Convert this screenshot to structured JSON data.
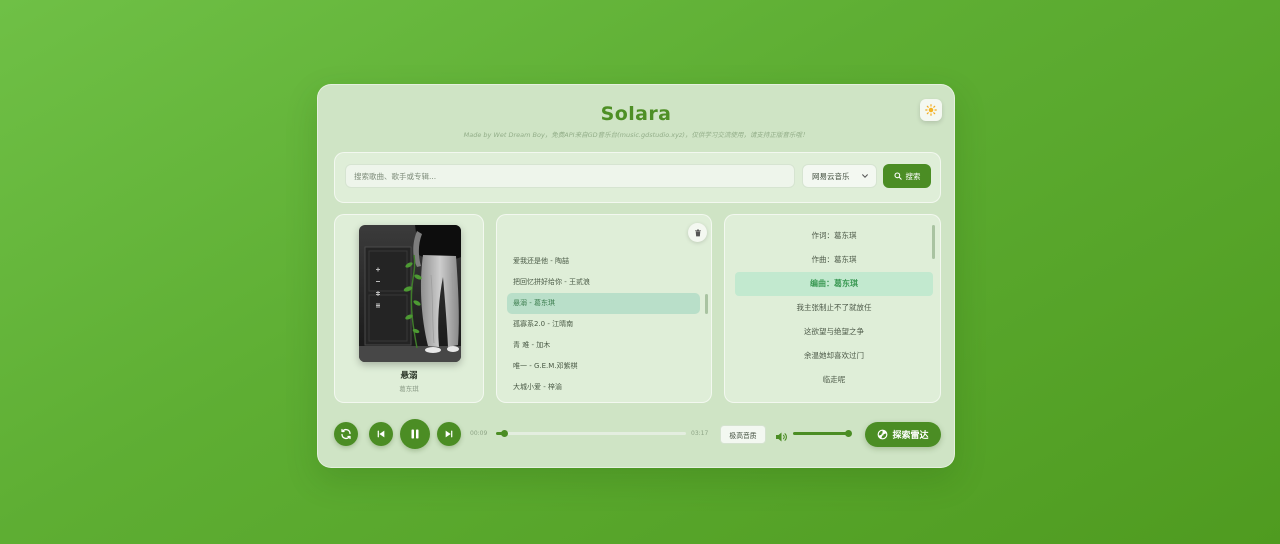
{
  "app": {
    "title": "Solara",
    "subtitle": "Made by Wet Dream Boy，免费API来自GD音乐台(music.gdstudio.xyz)，仅供学习交流使用，请支持正版音乐哦！"
  },
  "theme_toggle": {
    "icon": "sun-icon"
  },
  "search": {
    "placeholder": "搜索歌曲、歌手或专辑...",
    "value": "",
    "source": "网易云音乐",
    "button_label": "搜索",
    "button_icon": "search-icon"
  },
  "now_playing": {
    "title": "悬溺",
    "artist": "葛东琪"
  },
  "playlist": {
    "clear_icon": "trash-icon",
    "active_index": 2,
    "items": [
      "爱我还是他 - 陶喆",
      "把回忆拼好给你 - 王贰浪",
      "悬溺 - 葛东琪",
      "孤寡系2.0 - 江晴南",
      "青 难 - 加木",
      "唯一 - G.E.M.邓紫棋",
      "大城小爱 - 梓渝"
    ]
  },
  "lyrics": {
    "active_index": 2,
    "lines": [
      "作词：葛东琪",
      "作曲：葛东琪",
      "编曲：葛东琪",
      "我主张制止不了就放任",
      "这欲望与绝望之争",
      "余温她却喜欢过门",
      "临走呢"
    ]
  },
  "player": {
    "state": "playing",
    "current_time": "00:09",
    "total_time": "03:17",
    "progress": 0.046,
    "quality_label": "极高音质",
    "volume": 0.95,
    "explore_label": "探索雷达",
    "icons": [
      "repeat-icon",
      "previous-icon",
      "pause-icon",
      "next-icon",
      "volume-icon",
      "radar-icon"
    ]
  },
  "colors": {
    "accent": "#4b8d24",
    "title": "#4e8f25",
    "active_item": "#b9dfc9",
    "active_lyric": "#c2e9cf",
    "active_lyric_text": "#3c9a55"
  }
}
